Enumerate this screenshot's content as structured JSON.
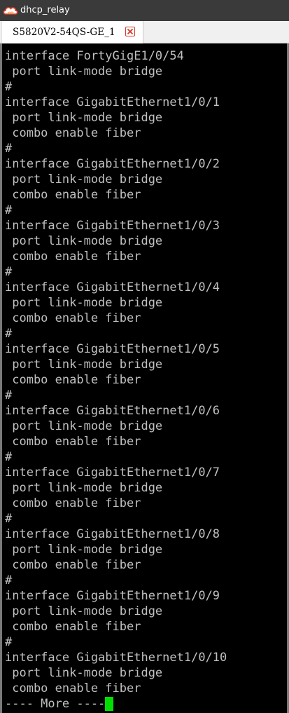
{
  "window": {
    "title": "dhcp_relay",
    "colors": {
      "titlebar": "#3a3a3a",
      "terminal_bg": "#000000",
      "text": "#c0c0c0",
      "cursor": "#00e000",
      "close_accent": "#d23b2a"
    }
  },
  "tabs": [
    {
      "label": "S5820V2-54QS-GE_1",
      "active": true,
      "close_icon": "close-icon"
    }
  ],
  "terminal": {
    "lines": [
      "interface FortyGigE1/0/54",
      " port link-mode bridge",
      "#",
      "interface GigabitEthernet1/0/1",
      " port link-mode bridge",
      " combo enable fiber",
      "#",
      "interface GigabitEthernet1/0/2",
      " port link-mode bridge",
      " combo enable fiber",
      "#",
      "interface GigabitEthernet1/0/3",
      " port link-mode bridge",
      " combo enable fiber",
      "#",
      "interface GigabitEthernet1/0/4",
      " port link-mode bridge",
      " combo enable fiber",
      "#",
      "interface GigabitEthernet1/0/5",
      " port link-mode bridge",
      " combo enable fiber",
      "#",
      "interface GigabitEthernet1/0/6",
      " port link-mode bridge",
      " combo enable fiber",
      "#",
      "interface GigabitEthernet1/0/7",
      " port link-mode bridge",
      " combo enable fiber",
      "#",
      "interface GigabitEthernet1/0/8",
      " port link-mode bridge",
      " combo enable fiber",
      "#",
      "interface GigabitEthernet1/0/9",
      " port link-mode bridge",
      " combo enable fiber",
      "#",
      "interface GigabitEthernet1/0/10",
      " port link-mode bridge",
      " combo enable fiber"
    ],
    "more_prompt": "---- More ----"
  }
}
